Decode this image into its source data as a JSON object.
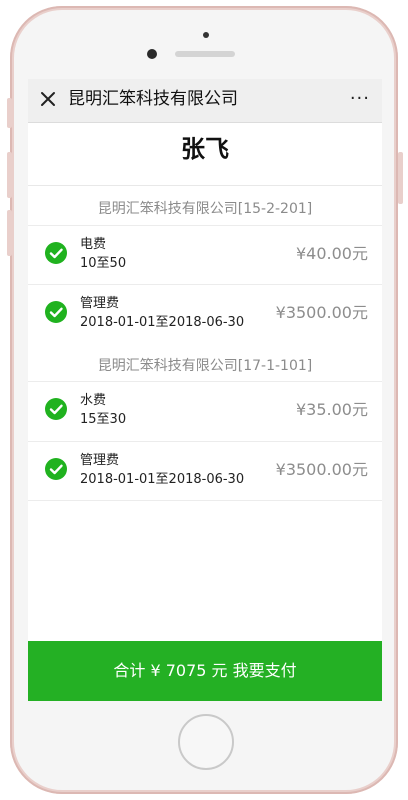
{
  "nav": {
    "title": "昆明汇笨科技有限公司",
    "more": "···",
    "close_icon": "close-icon"
  },
  "person": {
    "name": "张飞"
  },
  "groups": [
    {
      "header": "昆明汇笨科技有限公司[15-2-201]",
      "items": [
        {
          "name": "电费",
          "detail": "10至50",
          "amount": "¥40.00元",
          "checked": true
        },
        {
          "name": "管理费",
          "detail": "2018-01-01至2018-06-30",
          "amount": "¥3500.00元",
          "checked": true
        }
      ]
    },
    {
      "header": "昆明汇笨科技有限公司[17-1-101]",
      "items": [
        {
          "name": "水费",
          "detail": "15至30",
          "amount": "¥35.00元",
          "checked": true
        },
        {
          "name": "管理费",
          "detail": "2018-01-01至2018-06-30",
          "amount": "¥3500.00元",
          "checked": true
        }
      ]
    }
  ],
  "pay": {
    "label": "合计 ¥ 7075 元 我要支付"
  },
  "colors": {
    "accent_green": "#24b024",
    "check_green": "#20b21f"
  }
}
